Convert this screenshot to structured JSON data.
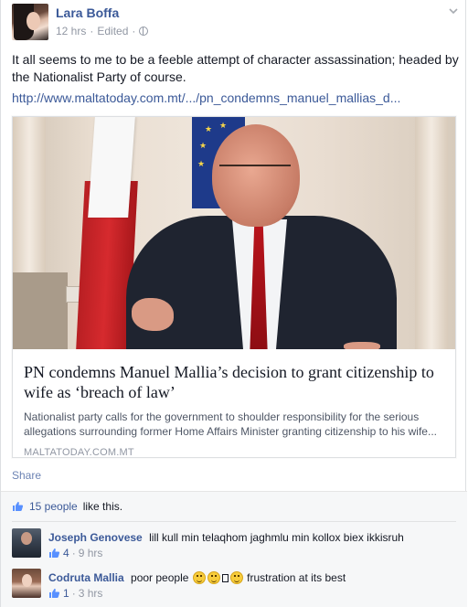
{
  "post": {
    "author": "Lara Boffa",
    "time": "12 hrs",
    "edited": "Edited",
    "separator": "·",
    "text": "It all seems to me to be a feeble attempt of character assassination; headed by the Nationalist Party of course.",
    "link_text": "http://www.maltatoday.com.mt/.../pn_condemns_manuel_mallias_d..."
  },
  "preview": {
    "title": "PN condemns Manuel Mallia’s decision to grant citizenship to wife as ‘breach of law’",
    "description": "Nationalist party calls for the government to shoulder responsibility for the serious allegations surrounding former Home Affairs Minister granting citizenship to his wife...",
    "source": "MALTATODAY.COM.MT"
  },
  "actions": {
    "share_label": "Share"
  },
  "likes": {
    "count_label": "15 people",
    "suffix": "like this."
  },
  "comments": [
    {
      "author": "Joseph Genovese",
      "text": "lill kull min telaqhom jaghmlu min kollox biex ikkisruh",
      "likes": "4",
      "time": "9 hrs"
    },
    {
      "author": "Codruta Mallia",
      "text_before": "poor people",
      "text_after": "frustration at its best",
      "likes": "1",
      "time": "3 hrs"
    }
  ],
  "icons": {
    "globe": "globe-icon",
    "chevron": "chevron-down-icon",
    "thumb": "thumbs-up-icon"
  },
  "colors": {
    "link": "#3b5998",
    "muted": "#9197a3",
    "feedback_bg": "#f6f7f8"
  }
}
